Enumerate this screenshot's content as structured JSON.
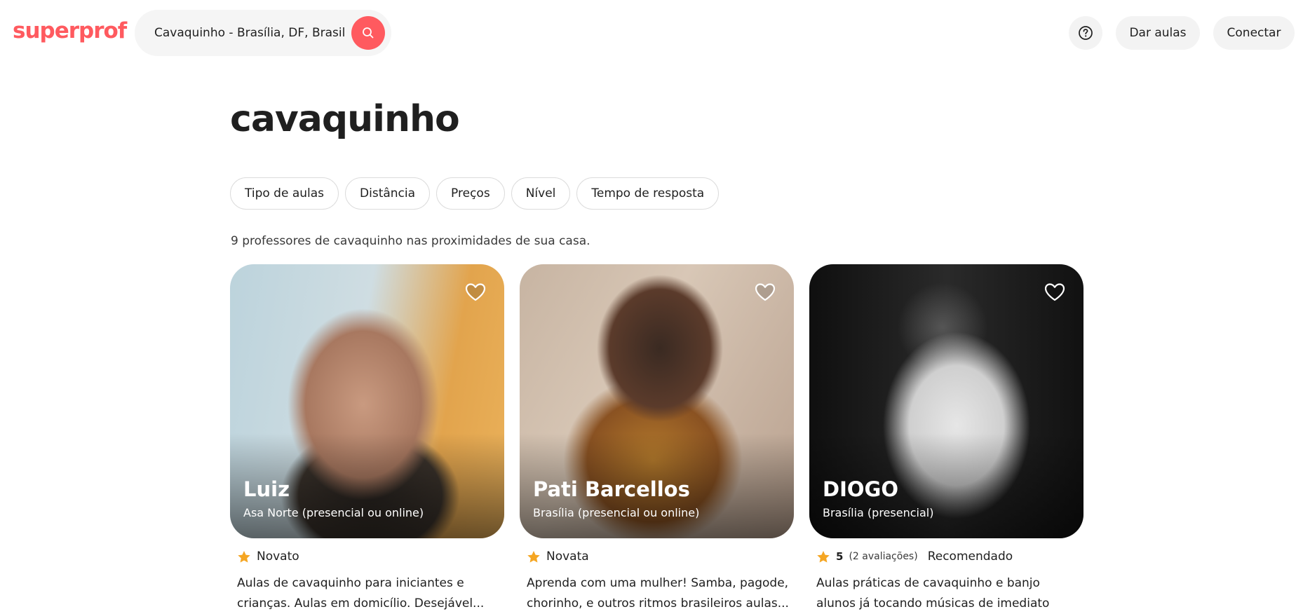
{
  "header": {
    "logo": "superprof",
    "search_value": "Cavaquinho - Brasília, DF, Brasil",
    "teach_label": "Dar aulas",
    "login_label": "Conectar"
  },
  "page": {
    "title": "cavaquinho",
    "filters": [
      "Tipo de aulas",
      "Distância",
      "Preços",
      "Nível",
      "Tempo de resposta"
    ],
    "result_count": "9 professores de cavaquinho nas proximidades de sua casa."
  },
  "teachers": [
    {
      "name": "Luiz",
      "location": "Asa Norte (presencial ou online)",
      "badge": "Novato",
      "rating": "",
      "reviews": "",
      "description": "Aulas de cavaquinho para iniciantes e crianças. Aulas em domicílio. Desejável..."
    },
    {
      "name": "Pati Barcellos",
      "location": "Brasília (presencial ou online)",
      "badge": "Novata",
      "rating": "",
      "reviews": "",
      "description": "Aprenda com uma mulher! Samba, pagode, chorinho, e outros ritmos brasileiros aulas..."
    },
    {
      "name": "DIOGO",
      "location": "Brasília (presencial)",
      "badge": "Recomendado",
      "rating": "5",
      "reviews": "(2 avaliações)",
      "description": "Aulas práticas de cavaquinho e banjo alunos já tocando músicas de imediato"
    }
  ],
  "colors": {
    "brand": "#ff5a5f",
    "star": "#f5a623"
  }
}
